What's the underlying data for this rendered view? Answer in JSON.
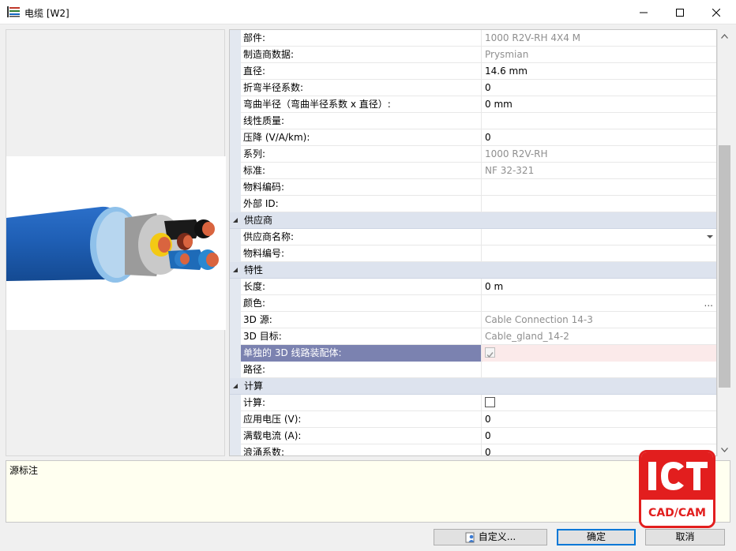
{
  "window": {
    "title": "电缆 [W2]"
  },
  "preview": {
    "image_name": "cable-cross-section-image"
  },
  "properties": [
    {
      "type": "row",
      "name": "部件:",
      "value": "1000 R2V-RH 4X4 M",
      "readonly": true
    },
    {
      "type": "row",
      "name": "制造商数据:",
      "value": "Prysmian",
      "readonly": true
    },
    {
      "type": "row",
      "name": "直径:",
      "value": "14.6 mm",
      "readonly": false
    },
    {
      "type": "row",
      "name": "折弯半径系数:",
      "value": "0",
      "readonly": false
    },
    {
      "type": "row",
      "name": "弯曲半径（弯曲半径系数 x 直径）:",
      "value": "0 mm",
      "readonly": false
    },
    {
      "type": "row",
      "name": "线性质量:",
      "value": "",
      "readonly": false
    },
    {
      "type": "row",
      "name": "压降 (V/A/km):",
      "value": "0",
      "readonly": false
    },
    {
      "type": "row",
      "name": "系列:",
      "value": "1000 R2V-RH",
      "readonly": true
    },
    {
      "type": "row",
      "name": "标准:",
      "value": "NF 32-321",
      "readonly": true
    },
    {
      "type": "row",
      "name": "物料编码:",
      "value": "",
      "readonly": false
    },
    {
      "type": "row",
      "name": "外部 ID:",
      "value": "",
      "readonly": false
    },
    {
      "type": "category",
      "name": "供应商"
    },
    {
      "type": "row",
      "name": "供应商名称:",
      "value": "",
      "readonly": false,
      "editor": "dropdown"
    },
    {
      "type": "row",
      "name": "物料编号:",
      "value": "",
      "readonly": false
    },
    {
      "type": "category",
      "name": "特性"
    },
    {
      "type": "row",
      "name": "长度:",
      "value": "0 m",
      "readonly": false
    },
    {
      "type": "row",
      "name": "颜色:",
      "value": "",
      "readonly": false,
      "editor": "ellipsis"
    },
    {
      "type": "row",
      "name": "3D 源:",
      "value": "Cable Connection 14-3",
      "readonly": true
    },
    {
      "type": "row",
      "name": "3D 目标:",
      "value": "Cable_gland_14-2",
      "readonly": true
    },
    {
      "type": "row",
      "name": "单独的 3D 线路装配体:",
      "value": "",
      "readonly": true,
      "editor": "checkbox",
      "checked": true,
      "selected": true
    },
    {
      "type": "row",
      "name": "路径:",
      "value": "",
      "readonly": false
    },
    {
      "type": "category",
      "name": "计算"
    },
    {
      "type": "row",
      "name": "计算:",
      "value": "",
      "readonly": false,
      "editor": "checkbox",
      "checked": false
    },
    {
      "type": "row",
      "name": "应用电压 (V):",
      "value": "0",
      "readonly": false
    },
    {
      "type": "row",
      "name": "满载电流 (A):",
      "value": "0",
      "readonly": false
    },
    {
      "type": "row",
      "name": "浪涌系数:",
      "value": "0",
      "readonly": false
    }
  ],
  "notes": {
    "label": "源标注"
  },
  "watermark": {
    "brand": "ICT",
    "tagline": "CAD/CAM"
  },
  "buttons": {
    "custom": "自定义...",
    "ok": "确定",
    "cancel": "取消"
  },
  "colors": {
    "selected_name_bg": "#7b82b0",
    "selected_value_bg": "#fbeaea",
    "category_bg": "#dde3ee",
    "notes_bg": "#fffff0",
    "logo_red": "#e21e1e"
  }
}
